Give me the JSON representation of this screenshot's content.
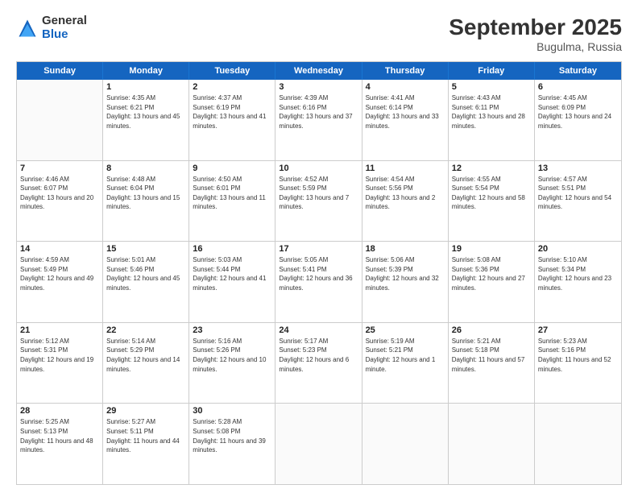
{
  "header": {
    "logo": {
      "general": "General",
      "blue": "Blue"
    },
    "title": "September 2025",
    "subtitle": "Bugulma, Russia"
  },
  "weekdays": [
    "Sunday",
    "Monday",
    "Tuesday",
    "Wednesday",
    "Thursday",
    "Friday",
    "Saturday"
  ],
  "weeks": [
    [
      {
        "day": "",
        "empty": true
      },
      {
        "day": "1",
        "rise": "4:35 AM",
        "set": "6:21 PM",
        "daylight": "13 hours and 45 minutes."
      },
      {
        "day": "2",
        "rise": "4:37 AM",
        "set": "6:19 PM",
        "daylight": "13 hours and 41 minutes."
      },
      {
        "day": "3",
        "rise": "4:39 AM",
        "set": "6:16 PM",
        "daylight": "13 hours and 37 minutes."
      },
      {
        "day": "4",
        "rise": "4:41 AM",
        "set": "6:14 PM",
        "daylight": "13 hours and 33 minutes."
      },
      {
        "day": "5",
        "rise": "4:43 AM",
        "set": "6:11 PM",
        "daylight": "13 hours and 28 minutes."
      },
      {
        "day": "6",
        "rise": "4:45 AM",
        "set": "6:09 PM",
        "daylight": "13 hours and 24 minutes."
      }
    ],
    [
      {
        "day": "7",
        "rise": "4:46 AM",
        "set": "6:07 PM",
        "daylight": "13 hours and 20 minutes."
      },
      {
        "day": "8",
        "rise": "4:48 AM",
        "set": "6:04 PM",
        "daylight": "13 hours and 15 minutes."
      },
      {
        "day": "9",
        "rise": "4:50 AM",
        "set": "6:01 PM",
        "daylight": "13 hours and 11 minutes."
      },
      {
        "day": "10",
        "rise": "4:52 AM",
        "set": "5:59 PM",
        "daylight": "13 hours and 7 minutes."
      },
      {
        "day": "11",
        "rise": "4:54 AM",
        "set": "5:56 PM",
        "daylight": "13 hours and 2 minutes."
      },
      {
        "day": "12",
        "rise": "4:55 AM",
        "set": "5:54 PM",
        "daylight": "12 hours and 58 minutes."
      },
      {
        "day": "13",
        "rise": "4:57 AM",
        "set": "5:51 PM",
        "daylight": "12 hours and 54 minutes."
      }
    ],
    [
      {
        "day": "14",
        "rise": "4:59 AM",
        "set": "5:49 PM",
        "daylight": "12 hours and 49 minutes."
      },
      {
        "day": "15",
        "rise": "5:01 AM",
        "set": "5:46 PM",
        "daylight": "12 hours and 45 minutes."
      },
      {
        "day": "16",
        "rise": "5:03 AM",
        "set": "5:44 PM",
        "daylight": "12 hours and 41 minutes."
      },
      {
        "day": "17",
        "rise": "5:05 AM",
        "set": "5:41 PM",
        "daylight": "12 hours and 36 minutes."
      },
      {
        "day": "18",
        "rise": "5:06 AM",
        "set": "5:39 PM",
        "daylight": "12 hours and 32 minutes."
      },
      {
        "day": "19",
        "rise": "5:08 AM",
        "set": "5:36 PM",
        "daylight": "12 hours and 27 minutes."
      },
      {
        "day": "20",
        "rise": "5:10 AM",
        "set": "5:34 PM",
        "daylight": "12 hours and 23 minutes."
      }
    ],
    [
      {
        "day": "21",
        "rise": "5:12 AM",
        "set": "5:31 PM",
        "daylight": "12 hours and 19 minutes."
      },
      {
        "day": "22",
        "rise": "5:14 AM",
        "set": "5:29 PM",
        "daylight": "12 hours and 14 minutes."
      },
      {
        "day": "23",
        "rise": "5:16 AM",
        "set": "5:26 PM",
        "daylight": "12 hours and 10 minutes."
      },
      {
        "day": "24",
        "rise": "5:17 AM",
        "set": "5:23 PM",
        "daylight": "12 hours and 6 minutes."
      },
      {
        "day": "25",
        "rise": "5:19 AM",
        "set": "5:21 PM",
        "daylight": "12 hours and 1 minute."
      },
      {
        "day": "26",
        "rise": "5:21 AM",
        "set": "5:18 PM",
        "daylight": "11 hours and 57 minutes."
      },
      {
        "day": "27",
        "rise": "5:23 AM",
        "set": "5:16 PM",
        "daylight": "11 hours and 52 minutes."
      }
    ],
    [
      {
        "day": "28",
        "rise": "5:25 AM",
        "set": "5:13 PM",
        "daylight": "11 hours and 48 minutes."
      },
      {
        "day": "29",
        "rise": "5:27 AM",
        "set": "5:11 PM",
        "daylight": "11 hours and 44 minutes."
      },
      {
        "day": "30",
        "rise": "5:28 AM",
        "set": "5:08 PM",
        "daylight": "11 hours and 39 minutes."
      },
      {
        "day": "",
        "empty": true
      },
      {
        "day": "",
        "empty": true
      },
      {
        "day": "",
        "empty": true
      },
      {
        "day": "",
        "empty": true
      }
    ]
  ]
}
